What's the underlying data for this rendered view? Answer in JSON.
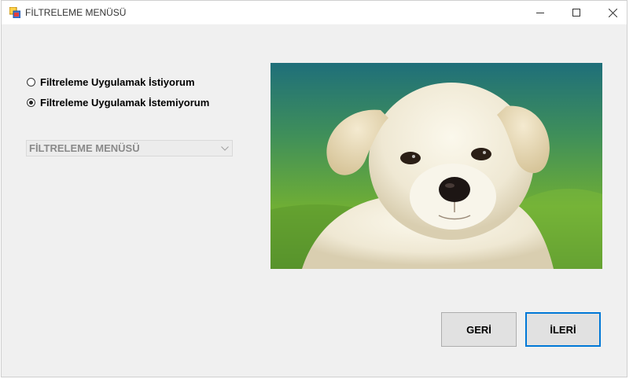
{
  "window": {
    "title": "FİLTRELEME MENÜSÜ",
    "icons": {
      "app": "app-icon",
      "minimize": "minimize-icon",
      "maximize": "maximize-icon",
      "close": "close-icon"
    }
  },
  "options": [
    {
      "label": "Filtreleme Uygulamak İstiyorum",
      "checked": false
    },
    {
      "label": "Filtreleme Uygulamak İstemiyorum",
      "checked": true
    }
  ],
  "filter_menu": {
    "selected": "FİLTRELEME MENÜSÜ",
    "enabled": false
  },
  "image": {
    "subject": "puppy-photo"
  },
  "buttons": {
    "back": "GERİ",
    "next": "İLERİ"
  },
  "colors": {
    "accent": "#0078d7",
    "window_bg": "#f0f0f0"
  }
}
